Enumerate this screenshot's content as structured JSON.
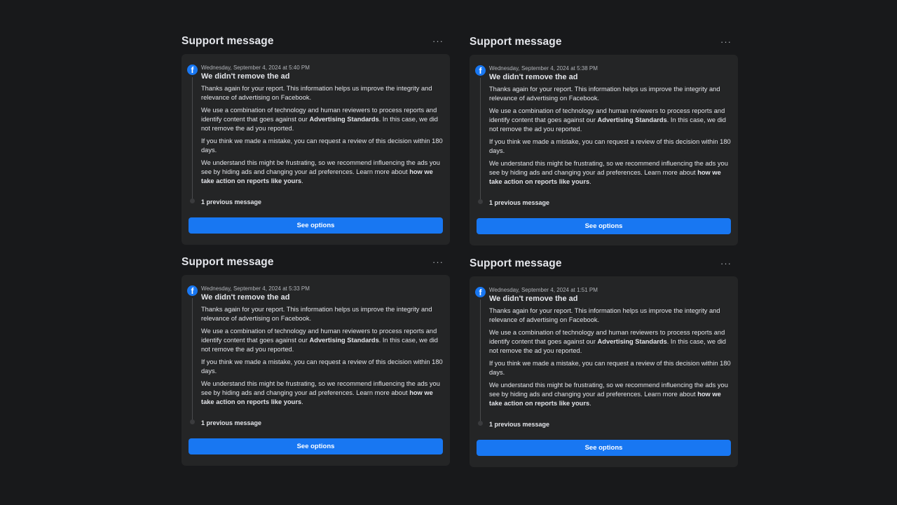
{
  "panels": [
    {
      "title": "Support message",
      "more": "···",
      "timestamp": "Wednesday, September 4, 2024 at 5:40 PM",
      "heading": "We didn't remove the ad",
      "p1": "Thanks again for your report. This information helps us improve the integrity and relevance of advertising on Facebook.",
      "p2_pre": "We use a combination of technology and human reviewers to process reports and identify content that goes against our ",
      "p2_bold": "Advertising Standards",
      "p2_post": ". In this case, we did not remove the ad you reported.",
      "p3": "If you think we made a mistake, you can request a review of this decision within 180 days.",
      "p4_pre": "We understand this might be frustrating, so we recommend influencing the ads you see by hiding ads and changing your ad preferences. Learn more about ",
      "p4_bold": "how we take action on reports like yours",
      "p4_post": ".",
      "previous": "1 previous message",
      "button": "See options",
      "icon": "facebook-icon"
    },
    {
      "title": "Support message",
      "more": "···",
      "timestamp": "Wednesday, September 4, 2024 at 5:38 PM",
      "heading": "We didn't remove the ad",
      "p1": "Thanks again for your report. This information helps us improve the integrity and relevance of advertising on Facebook.",
      "p2_pre": "We use a combination of technology and human reviewers to process reports and identify content that goes against our ",
      "p2_bold": "Advertising Standards",
      "p2_post": ". In this case, we did not remove the ad you reported.",
      "p3": "If you think we made a mistake, you can request a review of this decision within 180 days.",
      "p4_pre": "We understand this might be frustrating, so we recommend influencing the ads you see by hiding ads and changing your ad preferences. Learn more about ",
      "p4_bold": "how we take action on reports like yours",
      "p4_post": ".",
      "previous": "1 previous message",
      "button": "See options",
      "icon": "facebook-icon"
    },
    {
      "title": "Support message",
      "more": "···",
      "timestamp": "Wednesday, September 4, 2024 at 5:33 PM",
      "heading": "We didn't remove the ad",
      "p1": "Thanks again for your report. This information helps us improve the integrity and relevance of advertising on Facebook.",
      "p2_pre": "We use a combination of technology and human reviewers to process reports and identify content that goes against our ",
      "p2_bold": "Advertising Standards",
      "p2_post": ". In this case, we did not remove the ad you reported.",
      "p3": "If you think we made a mistake, you can request a review of this decision within 180 days.",
      "p4_pre": "We understand this might be frustrating, so we recommend influencing the ads you see by hiding ads and changing your ad preferences. Learn more about ",
      "p4_bold": "how we take action on reports like yours",
      "p4_post": ".",
      "previous": "1 previous message",
      "button": "See options",
      "icon": "facebook-icon"
    },
    {
      "title": "Support message",
      "more": "···",
      "timestamp": "Wednesday, September 4, 2024 at 1:51 PM",
      "heading": "We didn't remove the ad",
      "p1": "Thanks again for your report. This information helps us improve the integrity and relevance of advertising on Facebook.",
      "p2_pre": "We use a combination of technology and human reviewers to process reports and identify content that goes against our ",
      "p2_bold": "Advertising Standards",
      "p2_post": ". In this case, we did not remove the ad you reported.",
      "p3": "If you think we made a mistake, you can request a review of this decision within 180 days.",
      "p4_pre": "We understand this might be frustrating, so we recommend influencing the ads you see by hiding ads and changing your ad preferences. Learn more about ",
      "p4_bold": "how we take action on reports like yours",
      "p4_post": ".",
      "previous": "1 previous message",
      "button": "See options",
      "icon": "facebook-icon"
    }
  ],
  "colors": {
    "background": "#18191b",
    "card": "#242526",
    "accent": "#1877f2",
    "text": "#e4e6eb",
    "muted": "#b0b3b8"
  }
}
